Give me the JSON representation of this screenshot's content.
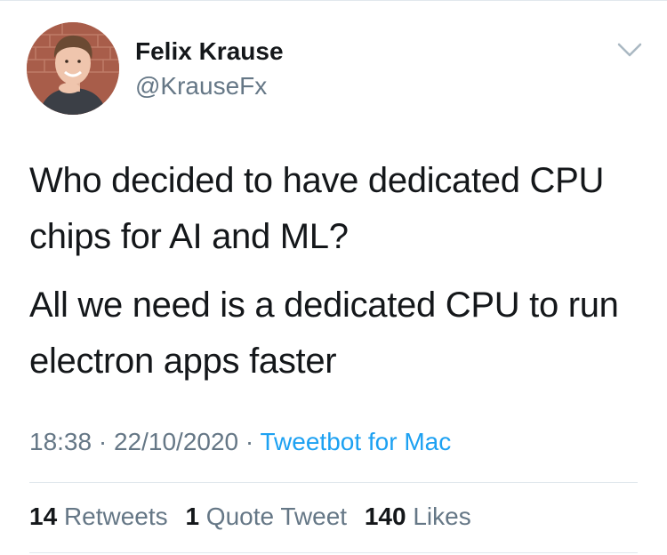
{
  "tweet": {
    "author": {
      "name": "Felix Krause",
      "handle": "@KrauseFx"
    },
    "text": [
      "Who decided to have dedicated CPU chips for AI and ML?",
      "All we need is a dedicated CPU to run electron apps faster"
    ],
    "time": "18:38",
    "date": "22/10/2020",
    "separator": "·",
    "source": "Tweetbot for Mac",
    "stats": {
      "retweets_count": "14",
      "retweets_label": "Retweets",
      "quotes_count": "1",
      "quotes_label": "Quote Tweet",
      "likes_count": "140",
      "likes_label": "Likes"
    }
  },
  "icons": {
    "menu": "chevron-down-icon"
  },
  "colors": {
    "text_primary": "#14171a",
    "text_secondary": "#657786",
    "link": "#1da1f2",
    "divider": "#e1e8ed"
  }
}
